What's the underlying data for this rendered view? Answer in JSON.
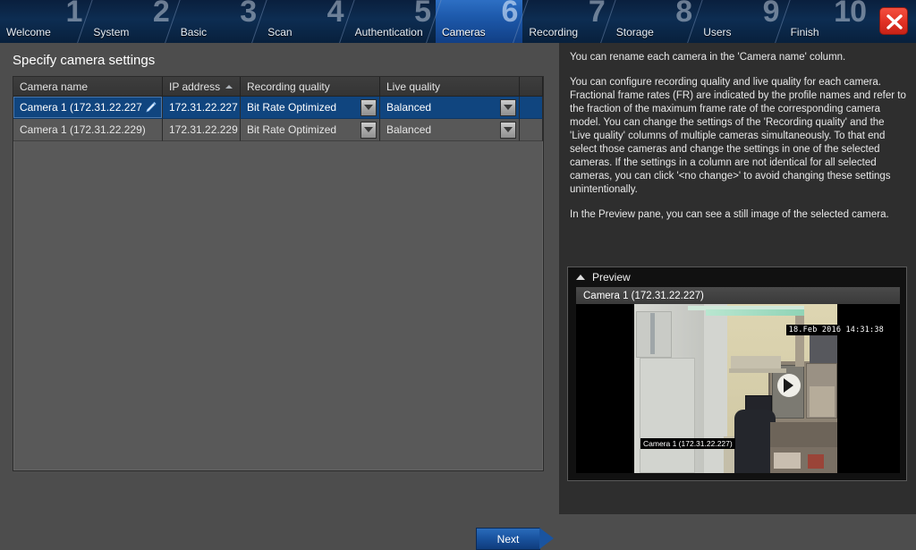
{
  "wizard": {
    "steps": [
      {
        "number": "1",
        "label": "Welcome",
        "active": false
      },
      {
        "number": "2",
        "label": "System",
        "active": false
      },
      {
        "number": "3",
        "label": "Basic",
        "active": false
      },
      {
        "number": "4",
        "label": "Scan",
        "active": false
      },
      {
        "number": "5",
        "label": "Authentication",
        "active": false
      },
      {
        "number": "6",
        "label": "Cameras",
        "active": true
      },
      {
        "number": "7",
        "label": "Recording",
        "active": false
      },
      {
        "number": "8",
        "label": "Storage",
        "active": false
      },
      {
        "number": "9",
        "label": "Users",
        "active": false
      },
      {
        "number": "10",
        "label": "Finish",
        "active": false
      }
    ],
    "close_icon": "close-icon",
    "active_color": "#1d59ab",
    "header_color": "#0d2d52",
    "close_color": "#e03124"
  },
  "page": {
    "title": "Specify camera settings"
  },
  "table": {
    "columns": [
      {
        "label": "Camera name",
        "sorted": false
      },
      {
        "label": "IP address",
        "sorted": true,
        "sort_dir": "asc"
      },
      {
        "label": "Recording quality",
        "sorted": false
      },
      {
        "label": "Live quality",
        "sorted": false
      },
      {
        "label": "",
        "sorted": false
      }
    ],
    "rows": [
      {
        "selected": true,
        "camera_name": "Camera 1 (172.31.22.227",
        "edit_icon": "pencil-icon",
        "ip_address": "172.31.22.227",
        "recording_quality": "Bit Rate Optimized",
        "live_quality": "Balanced"
      },
      {
        "selected": false,
        "camera_name": "Camera 1 (172.31.22.229)",
        "edit_icon": "",
        "ip_address": "172.31.22.229",
        "recording_quality": "Bit Rate Optimized",
        "live_quality": "Balanced"
      }
    ]
  },
  "footer": {
    "next_label": "Next"
  },
  "help": {
    "paragraphs": [
      "You can rename each camera in the 'Camera name' column.",
      "You can configure recording quality and live quality for each camera. Fractional frame rates (FR) are indicated by the profile names and refer to the fraction of the maximum frame rate of the corresponding camera model. You can change the settings of the 'Recording quality' and the 'Live quality' columns of multiple cameras simultaneously. To that end select those cameras and change the settings in one of the selected cameras. If the settings in a column are not identical for all selected cameras, you can click '<no change>' to avoid changing these settings unintentionally.",
      "In the Preview pane, you can see a still image of the selected camera."
    ]
  },
  "preview": {
    "panel_title": "Preview",
    "collapse_icon": "chevron-up-icon",
    "camera_title": "Camera 1 (172.31.22.227)",
    "timestamp_overlay": "18.Feb 2016   14:31:38",
    "camera_name_overlay": "Camera 1 (172.31.22.227)"
  }
}
